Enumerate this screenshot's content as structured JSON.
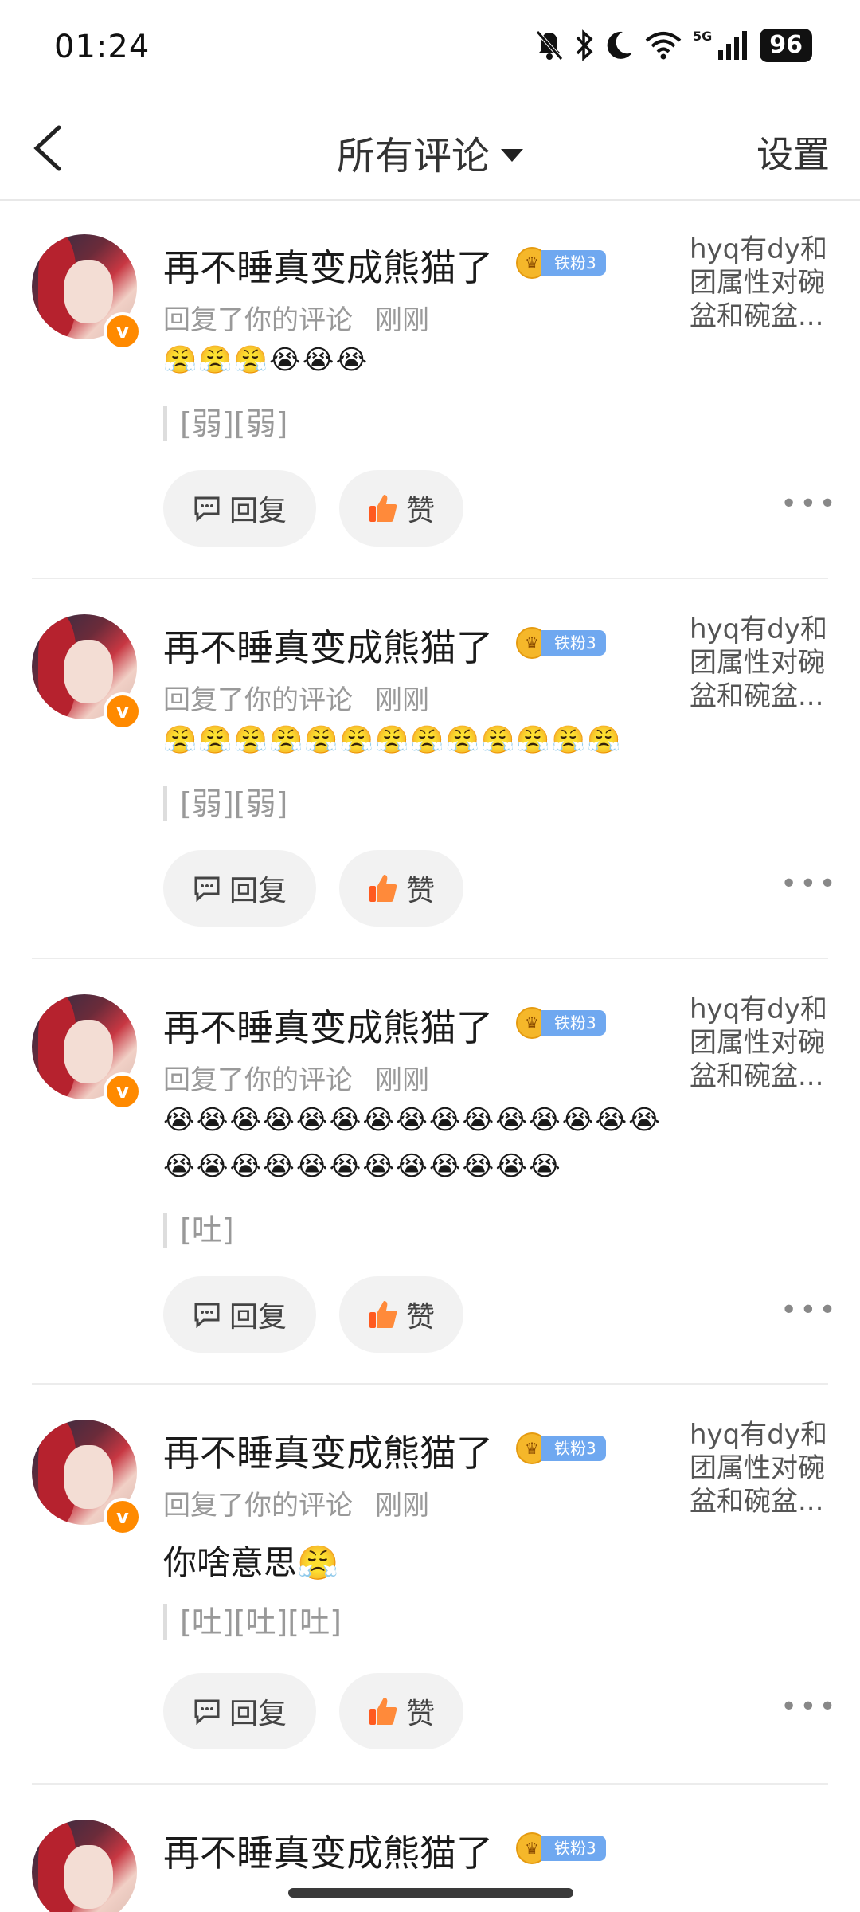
{
  "status_bar": {
    "time": "01:24",
    "network": "5G",
    "battery": "96"
  },
  "nav": {
    "title": "所有评论",
    "settings": "设置"
  },
  "comments": [
    {
      "username": "再不睡真变成熊猫了",
      "fan_badge": "铁粉3",
      "action": "回复了你的评论",
      "time": "刚刚",
      "emoji_lines": [
        "😤😤😤😭😭😭"
      ],
      "text": "",
      "quote": "[弱][弱]",
      "original_post": "hyq有dy和团属性对碗盆和碗盆...",
      "reply_label": "回复",
      "like_label": "赞"
    },
    {
      "username": "再不睡真变成熊猫了",
      "fan_badge": "铁粉3",
      "action": "回复了你的评论",
      "time": "刚刚",
      "emoji_lines": [
        "😤😤😤😤😤😤😤😤😤😤😤😤😤"
      ],
      "text": "",
      "quote": "[弱][弱]",
      "original_post": "hyq有dy和团属性对碗盆和碗盆...",
      "reply_label": "回复",
      "like_label": "赞"
    },
    {
      "username": "再不睡真变成熊猫了",
      "fan_badge": "铁粉3",
      "action": "回复了你的评论",
      "time": "刚刚",
      "emoji_lines": [
        "😭😭😭😭😭😭😭😭😭😭😭😭😭😭😭",
        "😭😭😭😭😭😭😭😭😭😭😭😭"
      ],
      "text": "",
      "quote": "[吐]",
      "original_post": "hyq有dy和团属性对碗盆和碗盆...",
      "reply_label": "回复",
      "like_label": "赞"
    },
    {
      "username": "再不睡真变成熊猫了",
      "fan_badge": "铁粉3",
      "action": "回复了你的评论",
      "time": "刚刚",
      "emoji_lines": [],
      "text": "你啥意思😤",
      "quote": "[吐][吐][吐]",
      "original_post": "hyq有dy和团属性对碗盆和碗盆...",
      "reply_label": "回复",
      "like_label": "赞"
    },
    {
      "username": "再不睡真变成熊猫了",
      "fan_badge": "铁粉3"
    }
  ],
  "colors": {
    "accent_orange": "#ff8a00",
    "like_red": "#ff5a1f",
    "fan_badge_blue": "#6fa8f0"
  }
}
